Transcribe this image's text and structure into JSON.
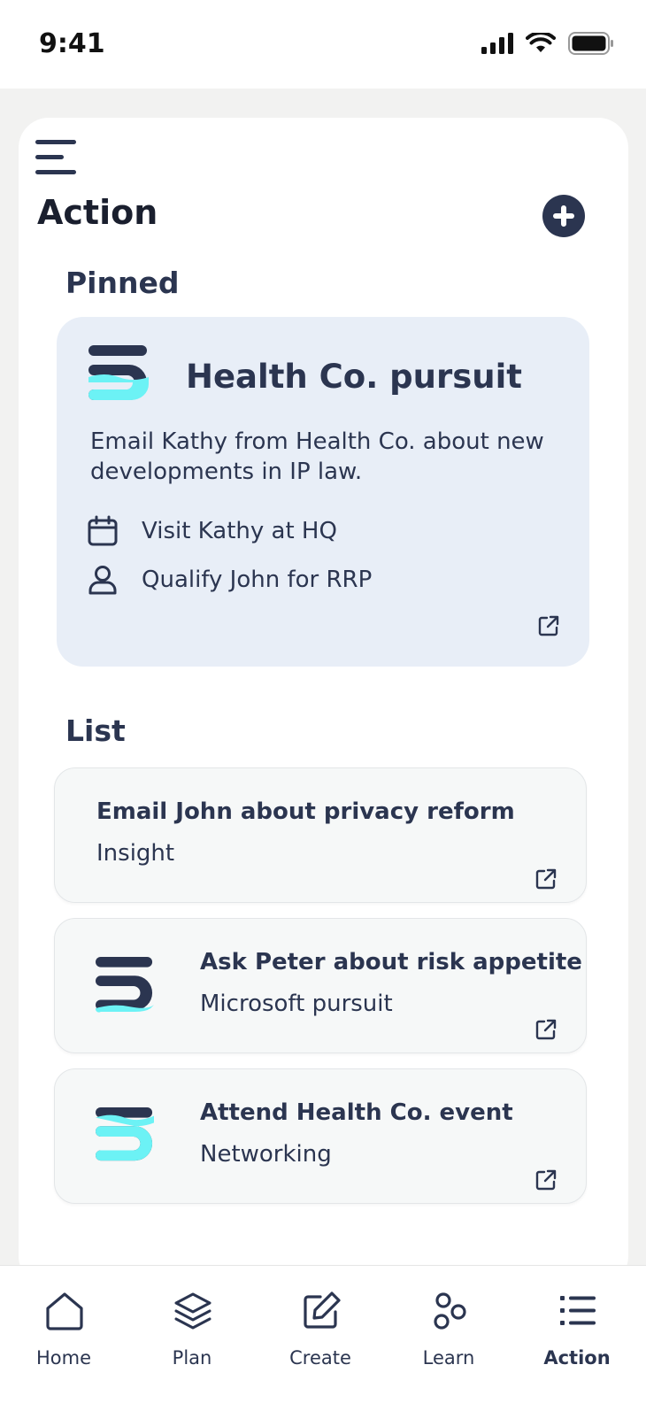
{
  "status_bar": {
    "time": "9:41"
  },
  "header": {
    "title": "Action"
  },
  "pinned": {
    "section_title": "Pinned",
    "card": {
      "title": "Health Co. pursuit",
      "description": "Email Kathy from Health Co. about new developments in IP law.",
      "rows": [
        {
          "icon": "calendar-icon",
          "text": "Visit Kathy at HQ"
        },
        {
          "icon": "user-icon",
          "text": "Qualify John for RRP"
        }
      ]
    }
  },
  "list": {
    "section_title": "List",
    "items": [
      {
        "title": "Email John about privacy reform",
        "subtitle": "Insight",
        "logo_fill": "none"
      },
      {
        "title": "Ask Peter about risk appetite",
        "subtitle": "Microsoft pursuit",
        "logo_fill": "low"
      },
      {
        "title": "Attend Health Co. event",
        "subtitle": "Networking",
        "logo_fill": "high"
      }
    ]
  },
  "tabs": [
    {
      "label": "Home",
      "icon": "home-icon"
    },
    {
      "label": "Plan",
      "icon": "layers-icon"
    },
    {
      "label": "Create",
      "icon": "edit-icon"
    },
    {
      "label": "Learn",
      "icon": "molecule-icon"
    },
    {
      "label": "Action",
      "icon": "list-icon",
      "active": true
    }
  ],
  "colors": {
    "navy": "#2b3550",
    "accent": "#6cf2f5",
    "pinned_bg": "#e8eef7"
  }
}
